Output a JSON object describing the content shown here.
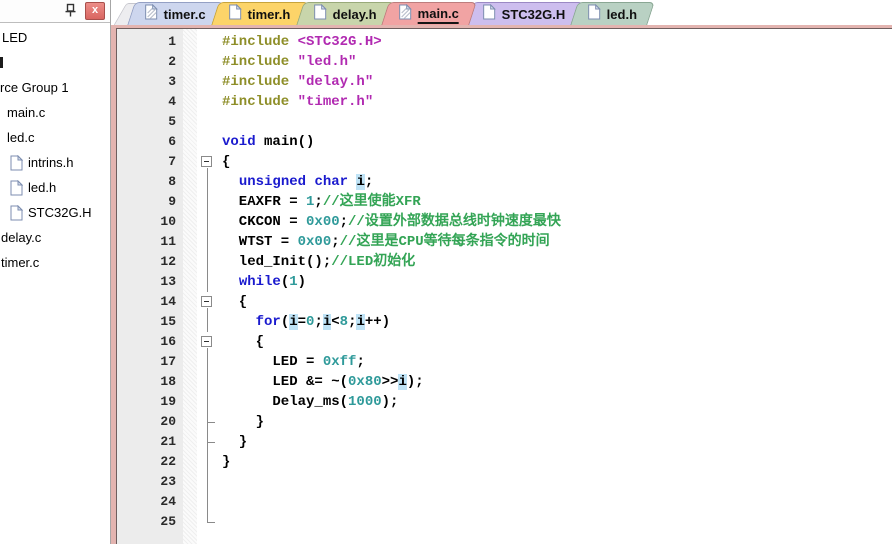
{
  "sidebar": {
    "close_glyph": "x",
    "items": [
      {
        "label": "LED",
        "pad": 2,
        "icon": false,
        "fragment": false
      },
      {
        "label": "",
        "pad": 0,
        "icon": false,
        "fragment": true
      },
      {
        "label": "rce Group 1",
        "pad": 0,
        "icon": false,
        "fragment": false
      },
      {
        "label": "main.c",
        "pad": 7,
        "icon": false,
        "fragment": false
      },
      {
        "label": "led.c",
        "pad": 7,
        "icon": false,
        "fragment": false
      },
      {
        "label": "intrins.h",
        "pad": 10,
        "icon": true,
        "fragment": false
      },
      {
        "label": "led.h",
        "pad": 10,
        "icon": true,
        "fragment": false
      },
      {
        "label": "STC32G.H",
        "pad": 10,
        "icon": true,
        "fragment": false
      },
      {
        "label": "delay.c",
        "pad": 1,
        "icon": false,
        "fragment": false
      },
      {
        "label": "timer.c",
        "pad": 1,
        "icon": false,
        "fragment": false
      }
    ]
  },
  "tabs": [
    {
      "label": "timer.c",
      "bg": "#cdd6ee",
      "border": "#94a0c4",
      "active": false,
      "modified": true
    },
    {
      "label": "timer.h",
      "bg": "#fcd469",
      "border": "#c7a43c",
      "active": false,
      "modified": false
    },
    {
      "label": "delay.h",
      "bg": "#c8d5ab",
      "border": "#99aa7a",
      "active": false,
      "modified": false
    },
    {
      "label": "main.c",
      "bg": "#f1a3a3",
      "border": "#bd7d7d",
      "active": true,
      "modified": true
    },
    {
      "label": "STC32G.H",
      "bg": "#cdbeee",
      "border": "#9b89c4",
      "active": false,
      "modified": false
    },
    {
      "label": "led.h",
      "bg": "#b9d1c3",
      "border": "#8aa794",
      "active": false,
      "modified": false
    }
  ],
  "editor": {
    "lines": [
      {
        "n": 1,
        "fold": "",
        "segs": [
          {
            "t": "#include ",
            "c": "dir"
          },
          {
            "t": "<STC32G.H>",
            "c": "str"
          }
        ]
      },
      {
        "n": 2,
        "fold": "",
        "segs": [
          {
            "t": "#include ",
            "c": "dir"
          },
          {
            "t": "\"led.h\"",
            "c": "str"
          }
        ]
      },
      {
        "n": 3,
        "fold": "",
        "segs": [
          {
            "t": "#include ",
            "c": "dir"
          },
          {
            "t": "\"delay.h\"",
            "c": "str"
          }
        ]
      },
      {
        "n": 4,
        "fold": "",
        "segs": [
          {
            "t": "#include ",
            "c": "dir"
          },
          {
            "t": "\"timer.h\"",
            "c": "str"
          }
        ]
      },
      {
        "n": 5,
        "fold": "",
        "segs": []
      },
      {
        "n": 6,
        "fold": "",
        "segs": [
          {
            "t": "void",
            "c": "kw"
          },
          {
            "t": " main()",
            "c": "p"
          }
        ]
      },
      {
        "n": 7,
        "fold": "box",
        "segs": [
          {
            "t": "{",
            "c": "p"
          }
        ]
      },
      {
        "n": 8,
        "fold": "line",
        "segs": [
          {
            "t": "  ",
            "c": "p"
          },
          {
            "t": "unsigned",
            "c": "kw"
          },
          {
            "t": " ",
            "c": "p"
          },
          {
            "t": "char",
            "c": "kw"
          },
          {
            "t": " ",
            "c": "p"
          },
          {
            "t": "i",
            "c": "hl"
          },
          {
            "t": ";",
            "c": "p"
          }
        ]
      },
      {
        "n": 9,
        "fold": "line",
        "segs": [
          {
            "t": "  EAXFR = ",
            "c": "p"
          },
          {
            "t": "1",
            "c": "num"
          },
          {
            "t": ";",
            "c": "p"
          },
          {
            "t": "//这里使能XFR",
            "c": "cmt"
          }
        ]
      },
      {
        "n": 10,
        "fold": "line",
        "segs": [
          {
            "t": "  CKCON = ",
            "c": "p"
          },
          {
            "t": "0x00",
            "c": "num"
          },
          {
            "t": ";",
            "c": "p"
          },
          {
            "t": "//设置外部数据总线时钟速度最快",
            "c": "cmt"
          }
        ]
      },
      {
        "n": 11,
        "fold": "line",
        "segs": [
          {
            "t": "  WTST = ",
            "c": "p"
          },
          {
            "t": "0x00",
            "c": "num"
          },
          {
            "t": ";",
            "c": "p"
          },
          {
            "t": "//这里是CPU等待每条指令的时间",
            "c": "cmt"
          }
        ]
      },
      {
        "n": 12,
        "fold": "line",
        "segs": [
          {
            "t": "  led_Init();",
            "c": "p"
          },
          {
            "t": "//LED初始化",
            "c": "cmt"
          }
        ]
      },
      {
        "n": 13,
        "fold": "line",
        "segs": [
          {
            "t": "  ",
            "c": "p"
          },
          {
            "t": "while",
            "c": "kw"
          },
          {
            "t": "(",
            "c": "p"
          },
          {
            "t": "1",
            "c": "num"
          },
          {
            "t": ")",
            "c": "p"
          }
        ]
      },
      {
        "n": 14,
        "fold": "box",
        "segs": [
          {
            "t": "  {",
            "c": "p"
          }
        ]
      },
      {
        "n": 15,
        "fold": "line",
        "segs": [
          {
            "t": "    ",
            "c": "p"
          },
          {
            "t": "for",
            "c": "kw"
          },
          {
            "t": "(",
            "c": "p"
          },
          {
            "t": "i",
            "c": "hl"
          },
          {
            "t": "=",
            "c": "p"
          },
          {
            "t": "0",
            "c": "num"
          },
          {
            "t": ";",
            "c": "p"
          },
          {
            "t": "i",
            "c": "hl"
          },
          {
            "t": "<",
            "c": "p"
          },
          {
            "t": "8",
            "c": "num"
          },
          {
            "t": ";",
            "c": "p"
          },
          {
            "t": "i",
            "c": "hl"
          },
          {
            "t": "++)",
            "c": "p"
          }
        ]
      },
      {
        "n": 16,
        "fold": "box",
        "segs": [
          {
            "t": "    {",
            "c": "p"
          }
        ]
      },
      {
        "n": 17,
        "fold": "line",
        "segs": [
          {
            "t": "      LED = ",
            "c": "p"
          },
          {
            "t": "0xff",
            "c": "num"
          },
          {
            "t": ";",
            "c": "p"
          }
        ]
      },
      {
        "n": 18,
        "fold": "line",
        "segs": [
          {
            "t": "      LED &= ~(",
            "c": "p"
          },
          {
            "t": "0x80",
            "c": "num"
          },
          {
            "t": ">>",
            "c": "p"
          },
          {
            "t": "i",
            "c": "hl"
          },
          {
            "t": ");",
            "c": "p"
          }
        ]
      },
      {
        "n": 19,
        "fold": "line",
        "segs": [
          {
            "t": "      Delay_ms(",
            "c": "p"
          },
          {
            "t": "1000",
            "c": "num"
          },
          {
            "t": ");",
            "c": "p"
          }
        ]
      },
      {
        "n": 20,
        "fold": "tick",
        "segs": [
          {
            "t": "    }",
            "c": "p"
          }
        ]
      },
      {
        "n": 21,
        "fold": "tick",
        "segs": [
          {
            "t": "  }",
            "c": "p"
          }
        ]
      },
      {
        "n": 22,
        "fold": "line",
        "segs": [
          {
            "t": "}",
            "c": "p"
          }
        ]
      },
      {
        "n": 23,
        "fold": "line",
        "segs": []
      },
      {
        "n": 24,
        "fold": "line",
        "segs": []
      },
      {
        "n": 25,
        "fold": "corner",
        "segs": []
      }
    ]
  },
  "colors": {
    "keyword": "#1a1ace",
    "directive": "#8e8e28",
    "string": "#b12ab1",
    "number": "#2f9a9a",
    "comment": "#33a455",
    "plain": "#000000",
    "word_highlight": "#bfe3f6",
    "frame": "#e3b4b0",
    "gutter_bg": "#ececec",
    "active_tab": "#f1a3a3"
  }
}
